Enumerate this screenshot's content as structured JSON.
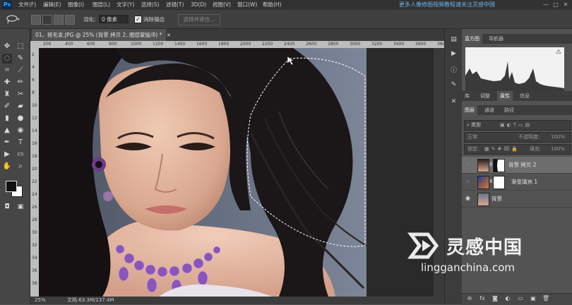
{
  "app": {
    "logo": "Ps"
  },
  "menu": [
    "文件(F)",
    "编辑(E)",
    "图像(I)",
    "图层(L)",
    "文字(Y)",
    "选择(S)",
    "滤镜(T)",
    "3D(D)",
    "视图(V)",
    "窗口(W)",
    "帮助(H)"
  ],
  "menubar_watermark": "更多人像修图视频教程请关注灵感中国",
  "window_buttons": [
    "—",
    "□",
    "✕"
  ],
  "options": {
    "feather_label": "羽化:",
    "feather_value": "0 像素",
    "antialias_label": "消除锯齿",
    "antialias_checked": true,
    "select_and_mask": "选择并遮住..."
  },
  "document": {
    "tab_title": "01、抠毛发.JPG @ 25% (背景 拷贝 2, 图层蒙版/8) *",
    "close": "×"
  },
  "ruler": {
    "h_ticks": [
      "200",
      "400",
      "600",
      "800",
      "1000",
      "1200",
      "1400",
      "1600",
      "1800",
      "2000",
      "2200",
      "2400",
      "2600",
      "2800",
      "3000",
      "3200",
      "3400",
      "3600",
      "3800",
      "4000"
    ],
    "v_ticks": [
      "2",
      "4",
      "6",
      "8",
      "10",
      "12",
      "14",
      "16",
      "18",
      "20",
      "22",
      "24",
      "26",
      "28",
      "30",
      "32",
      "34",
      "36",
      "38"
    ]
  },
  "status": {
    "zoom": "25%",
    "doc_info": "文档:63.3M/137.4M"
  },
  "panels": {
    "top_tabs": [
      "直方图",
      "导航器"
    ],
    "histogram_warning": "⚠",
    "mid_tabs": [
      "库",
      "调整",
      "属性",
      "信息"
    ],
    "active_mid_tab": "属性",
    "layers_tabs": [
      "图层",
      "通道",
      "路径"
    ],
    "kind_label": "类型",
    "blend_mode": "正常",
    "opacity_label": "不透明度:",
    "opacity_value": "100%",
    "lock_label": "锁定:",
    "fill_label": "填充:",
    "fill_value": "100%"
  },
  "layers": [
    {
      "name": "背景 拷贝 2",
      "visible": false,
      "selected": true
    },
    {
      "name": "渐变填充 1",
      "visible": false,
      "selected": false
    },
    {
      "name": "背景",
      "visible": true,
      "selected": false
    }
  ],
  "layers_footer": [
    "⊖",
    "fx",
    "◙",
    "◐",
    "▭",
    "▣",
    "🗑"
  ],
  "watermark": {
    "title": "灵感中国",
    "url": "lingganchina.com"
  },
  "colors": {
    "menubar": "#323232",
    "panel_bg": "#535353",
    "canvas_bg": "#6b7486",
    "accent_blue": "#6fb2e8"
  },
  "tool_icons": [
    "move-icon",
    "marquee-icon",
    "lasso-icon",
    "quick-select-icon",
    "crop-icon",
    "eyedropper-icon",
    "healing-icon",
    "brush-icon",
    "stamp-icon",
    "history-brush-icon",
    "eraser-icon",
    "gradient-icon",
    "blur-icon",
    "dodge-icon",
    "pen-icon",
    "type-icon",
    "path-select-icon",
    "shape-icon",
    "hand-icon",
    "zoom-icon"
  ]
}
